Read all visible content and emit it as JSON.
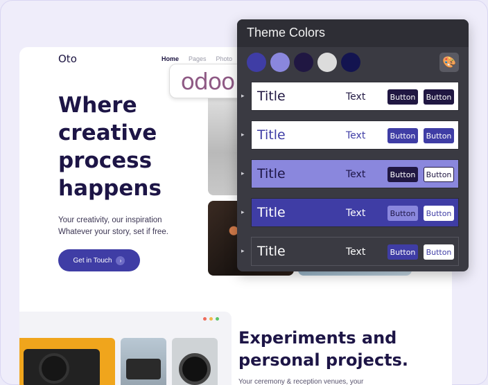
{
  "site": {
    "logo": "Oto",
    "nav": [
      "Home",
      "Pages",
      "Photo"
    ],
    "hero_title": "Where creative process happens",
    "hero_sub_1": "Your creativity, our inspiration",
    "hero_sub_2": "Whatever your story, set if free.",
    "cta_label": "Get in Touch",
    "cta_arrow": "›",
    "section_title": "Experiments and personal projects.",
    "section_sub": "Your ceremony & reception venues, your"
  },
  "badge": {
    "brand": "odoo"
  },
  "panel": {
    "title": "Theme Colors",
    "palette_icon": "palette-icon",
    "swatches": [
      "#3f3da5",
      "#8a87dd",
      "#201742",
      "#dcdcdc",
      "#131450"
    ],
    "presets": [
      {
        "title": "Title",
        "text": "Text",
        "b1": "Button",
        "b2": "Button"
      },
      {
        "title": "Title",
        "text": "Text",
        "b1": "Button",
        "b2": "Button"
      },
      {
        "title": "Title",
        "text": "Text",
        "b1": "Button",
        "b2": "Button"
      },
      {
        "title": "Title",
        "text": "Text",
        "b1": "Button",
        "b2": "Button"
      },
      {
        "title": "Title",
        "text": "Text",
        "b1": "Button",
        "b2": "Button"
      }
    ]
  },
  "colors": {
    "primary": "#3f3da5",
    "dark": "#1d1546",
    "panel": "#3a3a42"
  }
}
